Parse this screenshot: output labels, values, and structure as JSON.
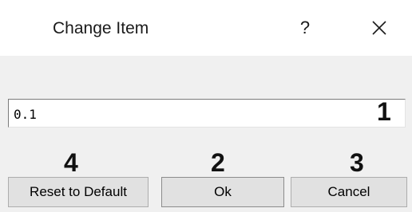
{
  "dialog": {
    "title": "Change Item",
    "help_label": "?",
    "close_icon": "close-icon"
  },
  "field": {
    "value": "0.1"
  },
  "callouts": {
    "one": "1",
    "two": "2",
    "three": "3",
    "four": "4"
  },
  "buttons": {
    "reset_label": "Reset to Default",
    "ok_label": "Ok",
    "cancel_label": "Cancel"
  },
  "colors": {
    "dialog_background": "#f0f0f0",
    "titlebar_background": "#ffffff",
    "button_face": "#e1e1e1"
  }
}
